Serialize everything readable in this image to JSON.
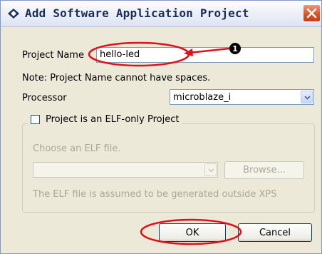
{
  "window": {
    "title": "Add Software Application Project",
    "icons": {
      "app": "diamond-app-icon",
      "close": "close-icon"
    }
  },
  "project_name": {
    "label": "Project Name",
    "value": "hello-led"
  },
  "note": "Note: Project Name cannot have spaces.",
  "processor": {
    "label": "Processor",
    "selected": "microblaze_i"
  },
  "elf_group": {
    "checkbox_label": "Project is an ELF-only Project",
    "checked": false,
    "choose_label": "Choose an ELF file.",
    "file_value": "",
    "browse_label": "Browse...",
    "info": "The ELF file is assumed to be generated outside XPS"
  },
  "buttons": {
    "ok": "OK",
    "cancel": "Cancel"
  },
  "annotation": {
    "marker": "1"
  },
  "colors": {
    "annotation": "#e0101a",
    "title_close": "#d9532a"
  }
}
